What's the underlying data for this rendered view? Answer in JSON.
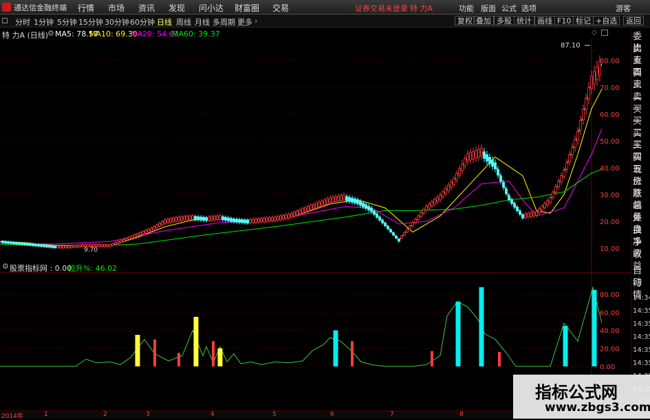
{
  "menubar": {
    "app_title": "通达信金融终端",
    "items": [
      "行情",
      "市场",
      "资讯",
      "发现",
      "问小达",
      "财富圈",
      "交易"
    ],
    "alert": "证券交易未登录",
    "stock_title": "特 力A",
    "right_items": [
      "功能",
      "版面",
      "公式",
      "选项"
    ],
    "guest": "游客"
  },
  "toolbar": {
    "periods": [
      "分时",
      "1分钟",
      "5分钟",
      "15分钟",
      "30分钟",
      "60分钟",
      "日线",
      "周线",
      "月线",
      "多周期",
      "更多"
    ],
    "active_period": "日线",
    "tools": [
      "复权",
      "叠加",
      "多股",
      "统计",
      "画线",
      "F10",
      "标记",
      "+自选",
      "返回"
    ]
  },
  "main_info": {
    "label": "特 力A (日线)",
    "ma5": "MA5: 78.57",
    "ma10": "MA10: 69.30",
    "ma20": "MA20: 54.63",
    "ma60": "MA60: 39.37"
  },
  "sub_info": {
    "label": "股票指标网 : 0.00",
    "value": "拉升%: 46.02"
  },
  "right_panel": {
    "top_items": [
      "委比",
      "卖五",
      "卖四",
      "卖三",
      "卖二",
      "卖一",
      "买一",
      "买二",
      "买三",
      "买四",
      "买五",
      "现价",
      "涨跌",
      "涨幅",
      "总量",
      "外盘",
      "换手",
      "净资",
      "收益"
    ],
    "bottom_items": [
      "自动",
      "行情"
    ],
    "times": [
      "14:34",
      "14:35",
      "14:35",
      "14:35",
      "14:35",
      "14:35",
      "14:35",
      "14:35",
      "14:35"
    ]
  },
  "timeline": [
    "2014年",
    "1",
    "2",
    "3",
    "4",
    "5",
    "6",
    "7",
    "8"
  ],
  "colors": {
    "up": "#ff3c3c",
    "down": "#54fcfc",
    "ma5": "#ffffff",
    "ma10": "#ffff00",
    "ma20": "#ff00ff",
    "ma60": "#00e600",
    "cyan": "#00f0f0",
    "yellow": "#ffff3a",
    "grid": "#780000"
  },
  "chart_data": [
    {
      "type": "candlestick",
      "title": "特 力A (日线)",
      "y_axis_labels": [
        "80.00",
        "70.00",
        "60.00",
        "50.00",
        "40.00",
        "30.00",
        "20.00",
        "10.00"
      ],
      "ylim": [
        5,
        100
      ],
      "annotations": [
        "87.10",
        "9.70"
      ],
      "series": [
        {
          "name": "MA5",
          "x": [
            0,
            20,
            40,
            60,
            80,
            100,
            120,
            140,
            160,
            180,
            200,
            220,
            240,
            260,
            280,
            300,
            320,
            340,
            360,
            380,
            400,
            420,
            440,
            460,
            480,
            500,
            520,
            540,
            560,
            580,
            600,
            620,
            640,
            660,
            680,
            700,
            720,
            740,
            760,
            780,
            800,
            820,
            840,
            860,
            875
          ],
          "values": [
            12.5,
            12,
            11.5,
            11,
            10.5,
            10.5,
            11,
            11,
            11,
            13,
            15,
            17,
            20,
            21,
            21.5,
            21,
            21.5,
            20.5,
            20,
            20.5,
            21,
            22,
            24,
            26,
            28,
            29,
            27.5,
            24.5,
            19,
            13,
            19,
            25,
            29,
            35,
            44,
            46,
            41,
            29,
            22,
            23,
            28,
            38,
            52,
            72,
            78.6
          ]
        },
        {
          "name": "MA10",
          "x": [
            0,
            40,
            80,
            120,
            160,
            200,
            240,
            280,
            320,
            360,
            400,
            440,
            480,
            520,
            560,
            600,
            640,
            680,
            720,
            760,
            780,
            800,
            820,
            840,
            860,
            875
          ],
          "values": [
            12.5,
            12,
            11,
            11,
            11,
            14,
            18,
            20.5,
            21,
            20.5,
            20.5,
            23,
            26.5,
            28,
            25,
            16,
            22,
            33,
            44,
            37,
            24,
            23,
            30,
            45,
            62,
            69.3
          ]
        },
        {
          "name": "MA20",
          "x": [
            0,
            80,
            160,
            240,
            320,
            400,
            460,
            500,
            540,
            580,
            620,
            660,
            700,
            740,
            760,
            780,
            820,
            860,
            875
          ],
          "values": [
            12,
            11.5,
            12.5,
            16.5,
            19.5,
            20.5,
            23.5,
            25.5,
            25,
            19,
            20,
            25,
            34,
            35,
            28,
            22,
            25,
            45,
            54.6
          ]
        },
        {
          "name": "MA60",
          "x": [
            0,
            100,
            200,
            300,
            400,
            500,
            560,
            600,
            660,
            700,
            740,
            780,
            820,
            860,
            875
          ],
          "values": [
            11.5,
            10.5,
            11.5,
            15,
            18,
            21.5,
            24,
            24,
            24.5,
            26,
            28,
            29,
            31,
            38,
            39.4
          ]
        }
      ]
    },
    {
      "type": "bar",
      "title": "股票指标网",
      "y_axis_labels": [
        "80.00",
        "60.00",
        "40.00",
        "20.00",
        "0.00"
      ],
      "ylim": [
        0,
        95
      ],
      "x": [
        200,
        225,
        260,
        285,
        310,
        320,
        488,
        512,
        628,
        666,
        700,
        726,
        822,
        864
      ],
      "values": [
        35,
        30,
        15,
        55,
        28,
        20,
        40,
        28,
        17,
        72,
        88,
        16,
        45,
        85
      ],
      "bar_types": [
        "yellow",
        "red",
        "red",
        "yellow",
        "red",
        "yellow",
        "cyan",
        "red",
        "red",
        "cyan",
        "cyan",
        "red",
        "cyan",
        "cyan"
      ],
      "series": [
        {
          "name": "拉升%",
          "x": [
            0,
            110,
            125,
            140,
            160,
            175,
            190,
            210,
            225,
            245,
            265,
            280,
            295,
            300,
            310,
            320,
            330,
            340,
            350,
            365,
            380,
            400,
            420,
            440,
            455,
            470,
            480,
            495,
            510,
            525,
            540,
            560,
            580,
            600,
            620,
            640,
            650,
            665,
            680,
            695,
            705,
            720,
            735,
            750,
            780,
            800,
            820,
            840,
            862,
            875
          ],
          "values": [
            0,
            0,
            8,
            4,
            5,
            2,
            10,
            30,
            14,
            6,
            12,
            40,
            12,
            22,
            4,
            22,
            5,
            14,
            3,
            5,
            2,
            5,
            4,
            6,
            18,
            24,
            32,
            28,
            18,
            5,
            2,
            0,
            0,
            0,
            2,
            12,
            56,
            72,
            66,
            52,
            36,
            30,
            16,
            0,
            0,
            0,
            48,
            28,
            88,
            48
          ]
        }
      ]
    }
  ]
}
